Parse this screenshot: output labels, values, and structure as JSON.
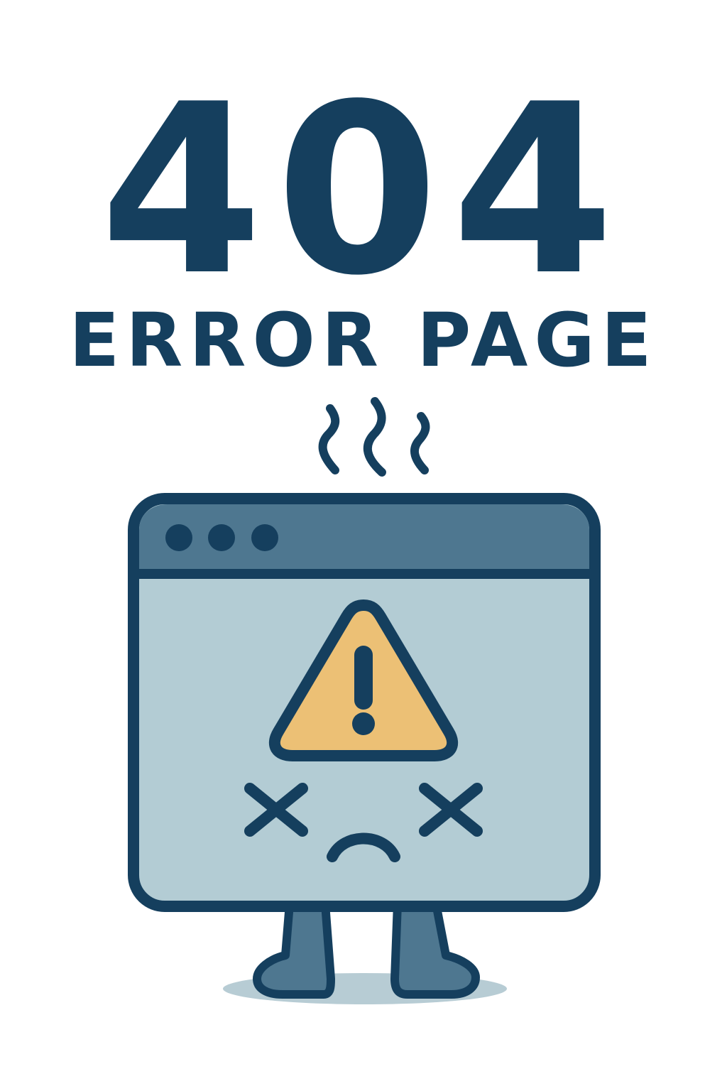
{
  "error": {
    "code": "404",
    "title": "ERROR PAGE"
  },
  "illustration": {
    "window_icon": "browser-window-icon",
    "window_controls": [
      "window-dot-icon",
      "window-dot-icon",
      "window-dot-icon"
    ],
    "warning_icon": "warning-triangle-icon",
    "face": [
      "x-eye-icon",
      "x-eye-icon",
      "frown-mouth-icon"
    ],
    "steam_icon": "steam-icon",
    "legs_icon": "legs-icon"
  },
  "colors": {
    "primary": "#153f5e",
    "window_header": "#4e7790",
    "window_body": "#b3ccd4",
    "warning": "#ecc075",
    "shadow": "#b7ccd4"
  }
}
